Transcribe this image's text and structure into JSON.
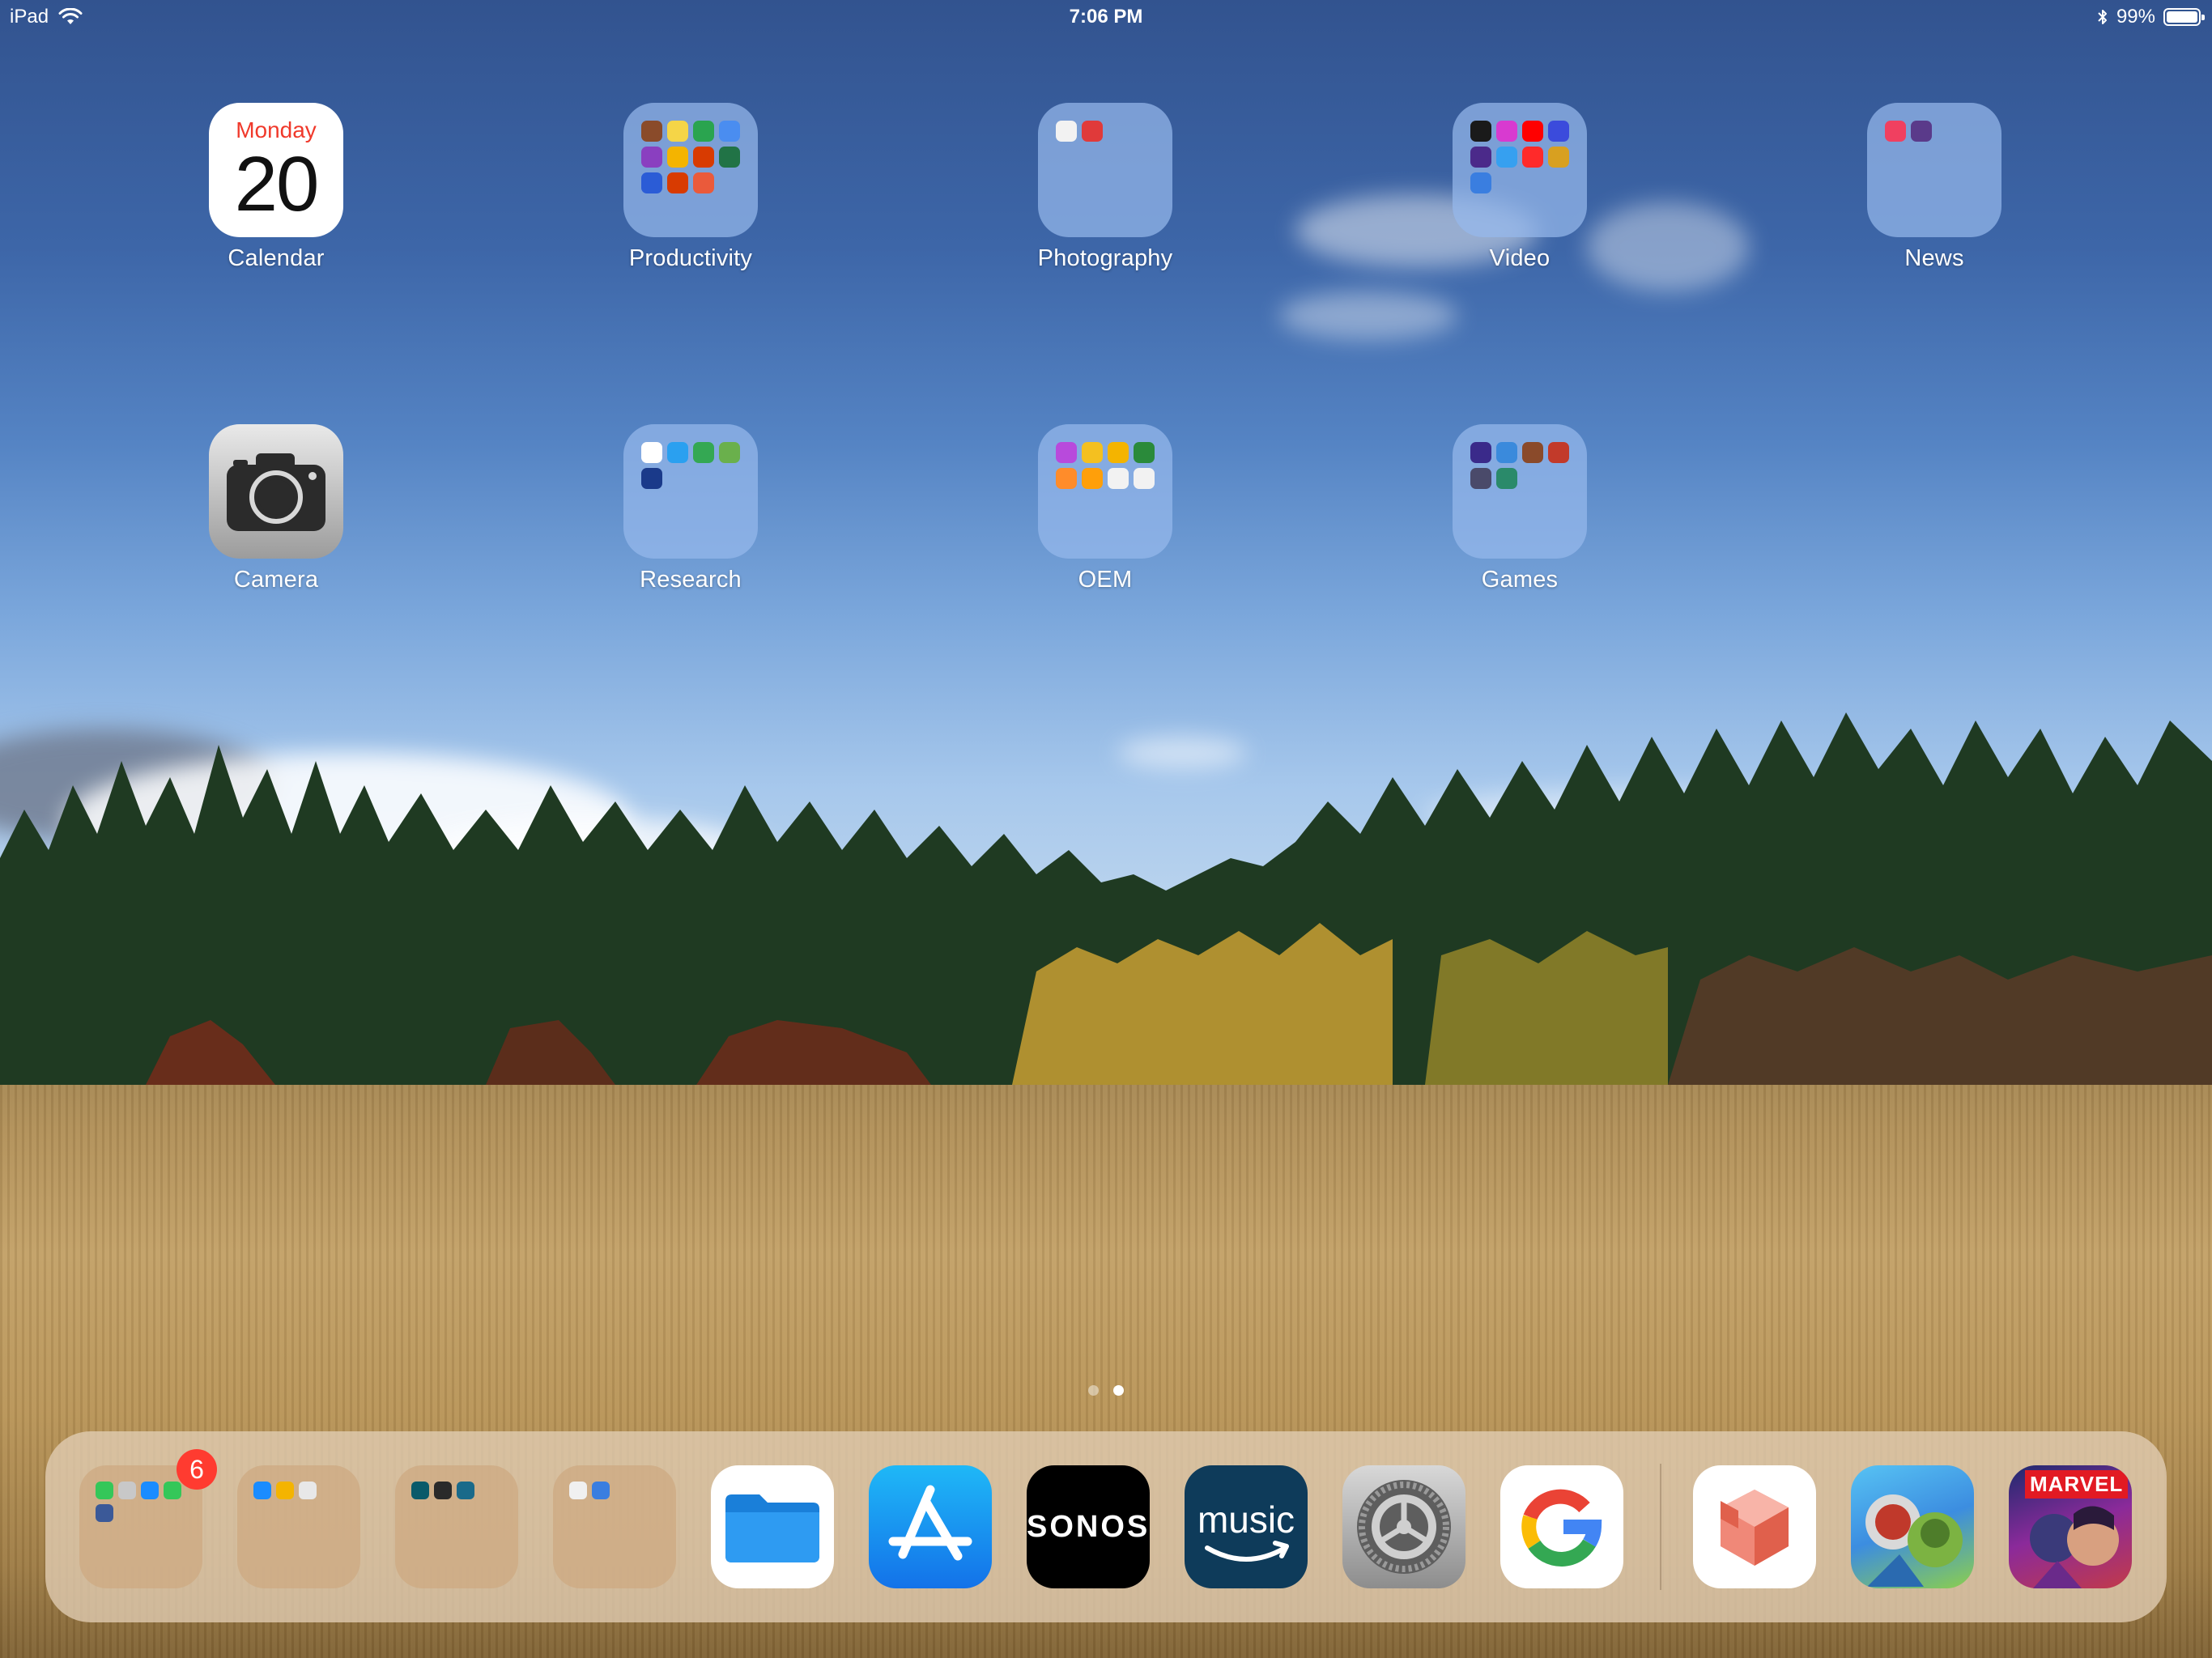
{
  "status_bar": {
    "device": "iPad",
    "time": "7:06 PM",
    "battery_text": "99%",
    "battery_level": 0.99,
    "icons": [
      "wifi-icon",
      "bluetooth-icon",
      "battery-icon"
    ]
  },
  "home": {
    "calendar": {
      "label": "Calendar",
      "day": "Monday",
      "date": "20"
    },
    "camera": {
      "label": "Camera"
    },
    "folders": {
      "productivity": {
        "label": "Productivity",
        "colors": [
          "#8a4b2a",
          "#f5d547",
          "#2aa44f",
          "#4a8df0",
          "#8a3fc0",
          "#f4b400",
          "#d83b01",
          "#217346",
          "#2b5cd6",
          "#d83b01",
          "#ea5a3b"
        ]
      },
      "photography": {
        "label": "Photography",
        "colors": [
          "#f2f2f2",
          "#e03a3a"
        ]
      },
      "video": {
        "label": "Video",
        "colors": [
          "#1a1a1a",
          "#d83ad0",
          "#ff0000",
          "#3b4bdc",
          "#4b2a8a",
          "#36a0f0",
          "#ff2a2a",
          "#d8a020",
          "#3a7ee0"
        ]
      },
      "news": {
        "label": "News",
        "colors": [
          "#f04060",
          "#5a3a8a"
        ]
      },
      "research": {
        "label": "Research",
        "colors": [
          "#ffffff",
          "#2aa0f0",
          "#34a853",
          "#6ab04c",
          "#1a3a8a"
        ]
      },
      "oem": {
        "label": "OEM",
        "colors": [
          "#b84adc",
          "#f4c020",
          "#f4b400",
          "#2a8a3a",
          "#ff8c2a",
          "#ff9f0a",
          "#f2f2f2",
          "#f2f2f2"
        ]
      },
      "games": {
        "label": "Games",
        "colors": [
          "#3a2a8a",
          "#3a8adc",
          "#8a4a2a",
          "#c23a2a",
          "#4a4a6a",
          "#2a8a6a"
        ]
      }
    }
  },
  "page_indicator": {
    "count": 2,
    "active": 2
  },
  "dock": {
    "folders": [
      {
        "name": "dock-folder-communication",
        "badge": "6",
        "colors": [
          "#34c759",
          "#c8c8c8",
          "#1a8cff",
          "#34c759",
          "#3b5998"
        ]
      },
      {
        "name": "dock-folder-browsers",
        "colors": [
          "#1a8cff",
          "#f4b400",
          "#e8e8e8"
        ]
      },
      {
        "name": "dock-folder-tools",
        "colors": [
          "#0a5a6a",
          "#2a2a2a",
          "#1a6a8a"
        ]
      },
      {
        "name": "dock-folder-media",
        "colors": [
          "#f0f0f0",
          "#3a7ee0"
        ]
      }
    ],
    "apps": {
      "files": {
        "icon": "folder-icon"
      },
      "app_store": {
        "icon": "app-store-icon"
      },
      "sonos": {
        "text": "SONOS"
      },
      "amazon_music": {
        "text": "music"
      },
      "settings": {
        "icon": "gear-icon"
      },
      "google": {
        "icon": "google-g-icon"
      },
      "cube": {
        "icon": "cube-icon"
      },
      "game_one": {
        "icon": "game-icon"
      },
      "marvel": {
        "text": "MARVEL"
      }
    }
  }
}
